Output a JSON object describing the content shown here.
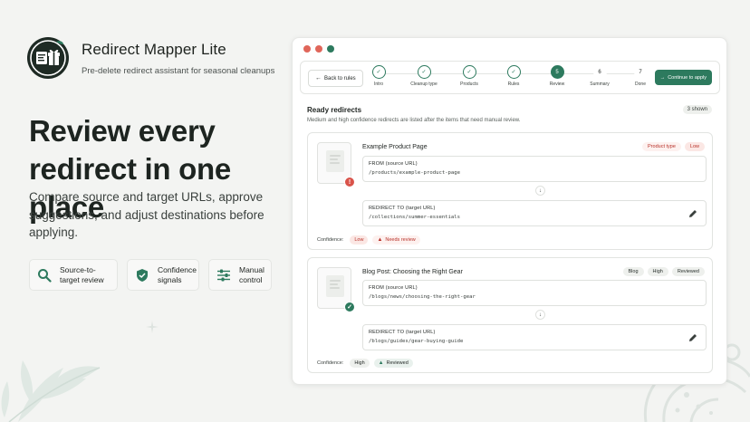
{
  "brand": {
    "app_name": "Redirect Mapper Lite",
    "tagline": "Pre-delete redirect assistant for seasonal cleanups",
    "accent_color": "#2d7a5e"
  },
  "hero": {
    "headline": "Review every redirect in one place",
    "subcopy": "Compare source and target URLs, approve suggestions, and adjust destinations before applying."
  },
  "features": [
    {
      "icon": "search-icon",
      "label": "Source-to-target review"
    },
    {
      "icon": "shield-check-icon",
      "label": "Confidence signals"
    },
    {
      "icon": "sliders-icon",
      "label": "Manual control"
    }
  ],
  "window": {
    "back_label": "Back to rules",
    "continue_label": "Continue to apply",
    "steps": [
      {
        "label": "Intro",
        "state": "done",
        "marker": "✓"
      },
      {
        "label": "Cleanup type",
        "state": "done",
        "marker": "✓"
      },
      {
        "label": "Products",
        "state": "done",
        "marker": "✓"
      },
      {
        "label": "Rules",
        "state": "done",
        "marker": "✓"
      },
      {
        "label": "Review",
        "state": "active",
        "marker": "5"
      },
      {
        "label": "Summary",
        "state": "todo",
        "marker": "6"
      },
      {
        "label": "Done",
        "state": "todo",
        "marker": "7"
      }
    ],
    "section_title": "Ready redirects",
    "count_badge": "3 shown",
    "section_desc": "Medium and high confidence redirects are listed after the items that need manual review.",
    "confidence_label": "Confidence:",
    "from_label": "FROM (source URL)",
    "to_label": "REDIRECT TO (target URL)",
    "cards": [
      {
        "title": "Example Product Page",
        "tags": [
          "Product type",
          "Low"
        ],
        "from": "/products/example-product-page",
        "to": "/collections/summer-essentials",
        "confidence": "Low",
        "status": "Needs review"
      },
      {
        "title": "Blog Post: Choosing the Right Gear",
        "tags": [
          "Blog",
          "High",
          "Reviewed"
        ],
        "from": "/blogs/news/choosing-the-right-gear",
        "to": "/blogs/guides/gear-buying-guide",
        "confidence": "High",
        "status": "Reviewed"
      }
    ]
  }
}
